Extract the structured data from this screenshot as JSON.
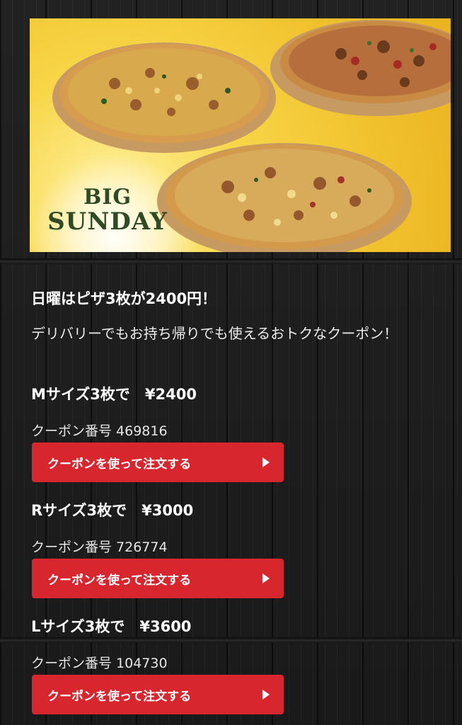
{
  "banner": {
    "logo_line1": "BIG",
    "logo_line2": "SUNDAY"
  },
  "headline": "日曜はピザ3枚が2400円！",
  "description": "デリバリーでもお持ち帰りでも使えるおトクなクーポン！",
  "coupons": [
    {
      "title": "Mサイズ3枚で　¥2400",
      "number": "クーポン番号 469816",
      "button_label": "クーポンを使って注文する",
      "button_icon": "play-arrow-icon"
    },
    {
      "title": "Rサイズ3枚で　¥3000",
      "number": "クーポン番号 726774",
      "button_label": "クーポンを使って注文する",
      "button_icon": "play-arrow-icon"
    },
    {
      "title": "Lサイズ3枚で　¥3600",
      "number": "クーポン番号 104730",
      "button_label": "クーポンを使って注文する",
      "button_icon": "play-arrow-icon"
    }
  ],
  "colors": {
    "button": "#d8262f",
    "background": "#1b1b1b",
    "banner_yellow": "#f1c12d",
    "logo_green": "#2f4a25"
  }
}
